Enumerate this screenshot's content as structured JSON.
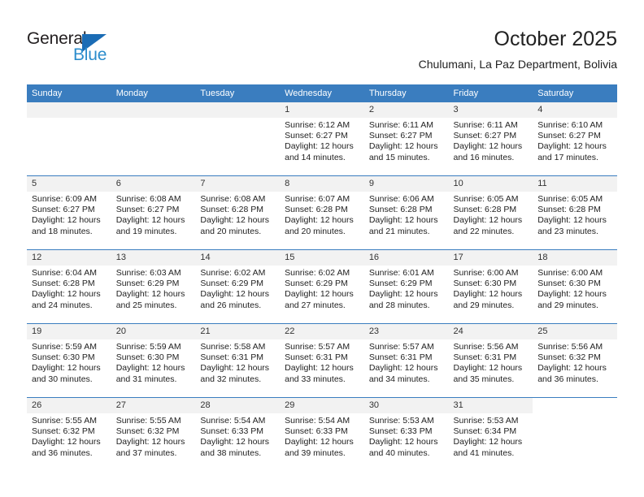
{
  "brand": {
    "word1": "General",
    "word2": "Blue",
    "triangle_color": "#1b6cb5",
    "word2_color": "#2b8ccc"
  },
  "header": {
    "title": "October 2025",
    "subtitle": "Chulumani, La Paz Department, Bolivia"
  },
  "theme": {
    "header_bg": "#3a7dbf",
    "daynum_bg": "#f2f2f2",
    "grid_line": "#3a7dbf"
  },
  "weekday_headers": [
    "Sunday",
    "Monday",
    "Tuesday",
    "Wednesday",
    "Thursday",
    "Friday",
    "Saturday"
  ],
  "weeks": [
    [
      {
        "day": "",
        "sunrise": "",
        "sunset": "",
        "daylight1": "",
        "daylight2": "",
        "empty": true
      },
      {
        "day": "",
        "sunrise": "",
        "sunset": "",
        "daylight1": "",
        "daylight2": "",
        "empty": true
      },
      {
        "day": "",
        "sunrise": "",
        "sunset": "",
        "daylight1": "",
        "daylight2": "",
        "empty": true
      },
      {
        "day": "1",
        "sunrise": "Sunrise: 6:12 AM",
        "sunset": "Sunset: 6:27 PM",
        "daylight1": "Daylight: 12 hours",
        "daylight2": "and 14 minutes."
      },
      {
        "day": "2",
        "sunrise": "Sunrise: 6:11 AM",
        "sunset": "Sunset: 6:27 PM",
        "daylight1": "Daylight: 12 hours",
        "daylight2": "and 15 minutes."
      },
      {
        "day": "3",
        "sunrise": "Sunrise: 6:11 AM",
        "sunset": "Sunset: 6:27 PM",
        "daylight1": "Daylight: 12 hours",
        "daylight2": "and 16 minutes."
      },
      {
        "day": "4",
        "sunrise": "Sunrise: 6:10 AM",
        "sunset": "Sunset: 6:27 PM",
        "daylight1": "Daylight: 12 hours",
        "daylight2": "and 17 minutes."
      }
    ],
    [
      {
        "day": "5",
        "sunrise": "Sunrise: 6:09 AM",
        "sunset": "Sunset: 6:27 PM",
        "daylight1": "Daylight: 12 hours",
        "daylight2": "and 18 minutes."
      },
      {
        "day": "6",
        "sunrise": "Sunrise: 6:08 AM",
        "sunset": "Sunset: 6:27 PM",
        "daylight1": "Daylight: 12 hours",
        "daylight2": "and 19 minutes."
      },
      {
        "day": "7",
        "sunrise": "Sunrise: 6:08 AM",
        "sunset": "Sunset: 6:28 PM",
        "daylight1": "Daylight: 12 hours",
        "daylight2": "and 20 minutes."
      },
      {
        "day": "8",
        "sunrise": "Sunrise: 6:07 AM",
        "sunset": "Sunset: 6:28 PM",
        "daylight1": "Daylight: 12 hours",
        "daylight2": "and 20 minutes."
      },
      {
        "day": "9",
        "sunrise": "Sunrise: 6:06 AM",
        "sunset": "Sunset: 6:28 PM",
        "daylight1": "Daylight: 12 hours",
        "daylight2": "and 21 minutes."
      },
      {
        "day": "10",
        "sunrise": "Sunrise: 6:05 AM",
        "sunset": "Sunset: 6:28 PM",
        "daylight1": "Daylight: 12 hours",
        "daylight2": "and 22 minutes."
      },
      {
        "day": "11",
        "sunrise": "Sunrise: 6:05 AM",
        "sunset": "Sunset: 6:28 PM",
        "daylight1": "Daylight: 12 hours",
        "daylight2": "and 23 minutes."
      }
    ],
    [
      {
        "day": "12",
        "sunrise": "Sunrise: 6:04 AM",
        "sunset": "Sunset: 6:28 PM",
        "daylight1": "Daylight: 12 hours",
        "daylight2": "and 24 minutes."
      },
      {
        "day": "13",
        "sunrise": "Sunrise: 6:03 AM",
        "sunset": "Sunset: 6:29 PM",
        "daylight1": "Daylight: 12 hours",
        "daylight2": "and 25 minutes."
      },
      {
        "day": "14",
        "sunrise": "Sunrise: 6:02 AM",
        "sunset": "Sunset: 6:29 PM",
        "daylight1": "Daylight: 12 hours",
        "daylight2": "and 26 minutes."
      },
      {
        "day": "15",
        "sunrise": "Sunrise: 6:02 AM",
        "sunset": "Sunset: 6:29 PM",
        "daylight1": "Daylight: 12 hours",
        "daylight2": "and 27 minutes."
      },
      {
        "day": "16",
        "sunrise": "Sunrise: 6:01 AM",
        "sunset": "Sunset: 6:29 PM",
        "daylight1": "Daylight: 12 hours",
        "daylight2": "and 28 minutes."
      },
      {
        "day": "17",
        "sunrise": "Sunrise: 6:00 AM",
        "sunset": "Sunset: 6:30 PM",
        "daylight1": "Daylight: 12 hours",
        "daylight2": "and 29 minutes."
      },
      {
        "day": "18",
        "sunrise": "Sunrise: 6:00 AM",
        "sunset": "Sunset: 6:30 PM",
        "daylight1": "Daylight: 12 hours",
        "daylight2": "and 29 minutes."
      }
    ],
    [
      {
        "day": "19",
        "sunrise": "Sunrise: 5:59 AM",
        "sunset": "Sunset: 6:30 PM",
        "daylight1": "Daylight: 12 hours",
        "daylight2": "and 30 minutes."
      },
      {
        "day": "20",
        "sunrise": "Sunrise: 5:59 AM",
        "sunset": "Sunset: 6:30 PM",
        "daylight1": "Daylight: 12 hours",
        "daylight2": "and 31 minutes."
      },
      {
        "day": "21",
        "sunrise": "Sunrise: 5:58 AM",
        "sunset": "Sunset: 6:31 PM",
        "daylight1": "Daylight: 12 hours",
        "daylight2": "and 32 minutes."
      },
      {
        "day": "22",
        "sunrise": "Sunrise: 5:57 AM",
        "sunset": "Sunset: 6:31 PM",
        "daylight1": "Daylight: 12 hours",
        "daylight2": "and 33 minutes."
      },
      {
        "day": "23",
        "sunrise": "Sunrise: 5:57 AM",
        "sunset": "Sunset: 6:31 PM",
        "daylight1": "Daylight: 12 hours",
        "daylight2": "and 34 minutes."
      },
      {
        "day": "24",
        "sunrise": "Sunrise: 5:56 AM",
        "sunset": "Sunset: 6:31 PM",
        "daylight1": "Daylight: 12 hours",
        "daylight2": "and 35 minutes."
      },
      {
        "day": "25",
        "sunrise": "Sunrise: 5:56 AM",
        "sunset": "Sunset: 6:32 PM",
        "daylight1": "Daylight: 12 hours",
        "daylight2": "and 36 minutes."
      }
    ],
    [
      {
        "day": "26",
        "sunrise": "Sunrise: 5:55 AM",
        "sunset": "Sunset: 6:32 PM",
        "daylight1": "Daylight: 12 hours",
        "daylight2": "and 36 minutes."
      },
      {
        "day": "27",
        "sunrise": "Sunrise: 5:55 AM",
        "sunset": "Sunset: 6:32 PM",
        "daylight1": "Daylight: 12 hours",
        "daylight2": "and 37 minutes."
      },
      {
        "day": "28",
        "sunrise": "Sunrise: 5:54 AM",
        "sunset": "Sunset: 6:33 PM",
        "daylight1": "Daylight: 12 hours",
        "daylight2": "and 38 minutes."
      },
      {
        "day": "29",
        "sunrise": "Sunrise: 5:54 AM",
        "sunset": "Sunset: 6:33 PM",
        "daylight1": "Daylight: 12 hours",
        "daylight2": "and 39 minutes."
      },
      {
        "day": "30",
        "sunrise": "Sunrise: 5:53 AM",
        "sunset": "Sunset: 6:33 PM",
        "daylight1": "Daylight: 12 hours",
        "daylight2": "and 40 minutes."
      },
      {
        "day": "31",
        "sunrise": "Sunrise: 5:53 AM",
        "sunset": "Sunset: 6:34 PM",
        "daylight1": "Daylight: 12 hours",
        "daylight2": "and 41 minutes."
      },
      {
        "day": "",
        "sunrise": "",
        "sunset": "",
        "daylight1": "",
        "daylight2": "",
        "blank": true
      }
    ]
  ]
}
